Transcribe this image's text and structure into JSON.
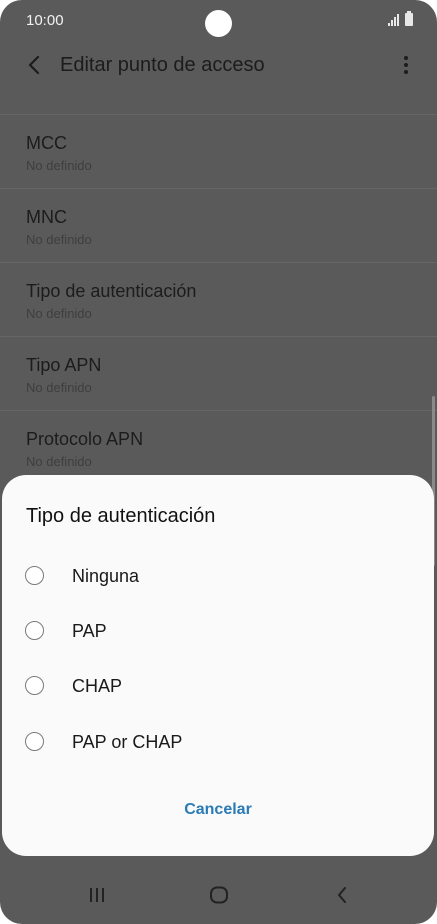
{
  "status_bar": {
    "time": "10:00"
  },
  "app_bar": {
    "title": "Editar punto de acceso"
  },
  "settings": [
    {
      "title": "MCC",
      "value": "No definido"
    },
    {
      "title": "MNC",
      "value": "No definido"
    },
    {
      "title": "Tipo de autenticación",
      "value": "No definido"
    },
    {
      "title": "Tipo APN",
      "value": "No definido"
    },
    {
      "title": "Protocolo APN",
      "value": "No definido"
    }
  ],
  "dialog": {
    "title": "Tipo de autenticación",
    "options": [
      "Ninguna",
      "PAP",
      "CHAP",
      "PAP or CHAP"
    ],
    "cancel_label": "Cancelar"
  },
  "colors": {
    "accent": "#2a7ab6",
    "scrim": "#5a5a5a",
    "sheet": "#fafafa"
  }
}
